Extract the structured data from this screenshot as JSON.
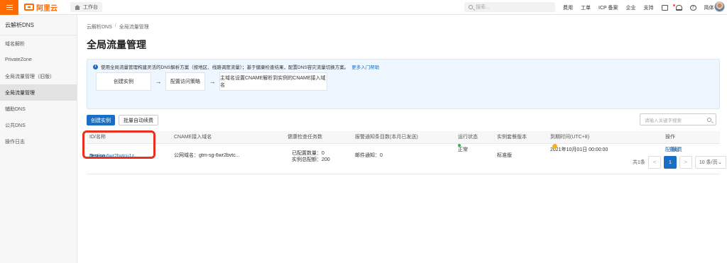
{
  "topbar": {
    "brand": "阿里云",
    "workspace_label": "工作台",
    "search_placeholder": "搜索...",
    "links": [
      "费用",
      "工单",
      "ICP 备案",
      "企业",
      "支持"
    ],
    "language": "简体"
  },
  "sidebar": {
    "title": "云解析DNS",
    "items": [
      {
        "label": "域名解析"
      },
      {
        "label": "PrivateZone"
      },
      {
        "label": "全局流量管理（旧版）"
      },
      {
        "label": "全局流量管理"
      },
      {
        "label": "辅助DNS"
      },
      {
        "label": "公共DNS"
      },
      {
        "label": "操作日志"
      }
    ],
    "active_index": 3
  },
  "breadcrumb": [
    "云解析DNS",
    "全局流量管理"
  ],
  "page_title": "全局流量管理",
  "info": {
    "text": "使用全局流量管理构建灵活的DNS解析方案（按地区、线路调度流量）；基于健康检查结果，配置DNS容灾流量切换方案。",
    "link": "更多入门帮助",
    "steps": [
      "创建实例",
      "配置访问策略",
      "主域名设置CNAME解析到实例的CNAME接入域名"
    ]
  },
  "toolbar": {
    "create_label": "创建实例",
    "batch_label": "批量自动续费",
    "search_placeholder": "请输入关键字搜索"
  },
  "table": {
    "headers": [
      "ID/名称",
      "CNAME接入域名",
      "健康检查任务数",
      "报警通知条目数(本月已发送)",
      "运行状态",
      "实例套餐版本",
      "到期时间(UTC+8)",
      "操作"
    ],
    "rows": [
      {
        "id": "gtm-sg-6wr2bvtcu1z",
        "name": "Testing",
        "cname": "公网域名：gtm-sg-6wr2bvtc...",
        "health_configured": "已配置数量：0",
        "health_instance": "实例总配额：200",
        "alerts": "邮件通知：0",
        "status": "正常",
        "plan": "标准版",
        "expire": "2021年10月01日 00:00:00",
        "actions": [
          "配置",
          "升级",
          "续费"
        ]
      }
    ]
  },
  "pagination": {
    "total": "共1条",
    "prev": "<",
    "current": "1",
    "next": ">",
    "page_size": "10 条/页"
  },
  "colors": {
    "brand": "#ff6a00",
    "primary": "#1a6ec4",
    "highlight_box": "#e8311e",
    "status_ok": "#2eb64b",
    "warning": "#f5b21a"
  }
}
